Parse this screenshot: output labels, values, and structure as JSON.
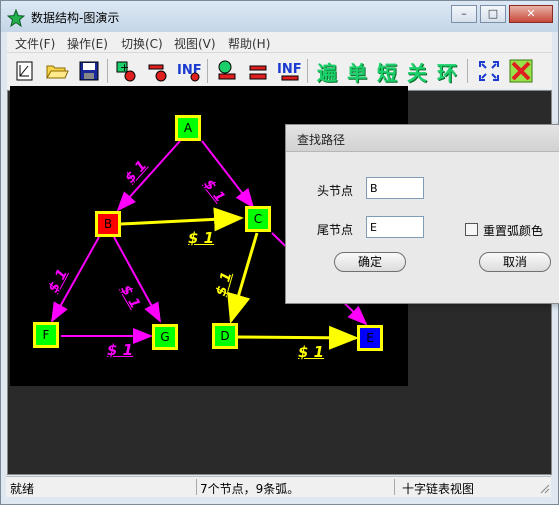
{
  "window": {
    "title": "数据结构-图演示",
    "controls": {
      "minimize": "–",
      "maximize": "□",
      "close": "✕"
    }
  },
  "menu": [
    "文件(F)",
    "操作(E)",
    "切换(C)",
    "视图(V)",
    "帮助(H)"
  ],
  "toolbar": {
    "icons": [
      "new-file-icon",
      "open-folder-icon",
      "save-icon",
      "add-node-icon",
      "delete-node-icon",
      "infinity-node-icon",
      "add-arc-icon",
      "delete-arc-icon",
      "infinity-arc-icon",
      "traverse-icon",
      "fit-view-icon",
      "close-red-icon"
    ],
    "text_buttons": [
      "遍",
      "单",
      "短",
      "关",
      "环"
    ]
  },
  "graph": {
    "nodes": [
      {
        "id": "A",
        "color": "#00ff00"
      },
      {
        "id": "B",
        "color": "#ff0000"
      },
      {
        "id": "C",
        "color": "#00ff00"
      },
      {
        "id": "D",
        "color": "#00ff00"
      },
      {
        "id": "E",
        "color": "#0000ff"
      },
      {
        "id": "F",
        "color": "#00ff00"
      },
      {
        "id": "G",
        "color": "#00ff00"
      }
    ],
    "edges": [
      {
        "from": "A",
        "to": "B",
        "label": "$ 1",
        "color": "#ff00ff"
      },
      {
        "from": "A",
        "to": "C",
        "label": "$ 1",
        "color": "#ff00ff"
      },
      {
        "from": "B",
        "to": "C",
        "label": "$ 1",
        "color": "#ffff00"
      },
      {
        "from": "B",
        "to": "F",
        "label": "$ 1",
        "color": "#ff00ff"
      },
      {
        "from": "B",
        "to": "G",
        "label": "$ 1",
        "color": "#ff00ff"
      },
      {
        "from": "F",
        "to": "G",
        "label": "$ 1",
        "color": "#ff00ff"
      },
      {
        "from": "C",
        "to": "D",
        "label": "$ 1",
        "color": "#ffff00"
      },
      {
        "from": "D",
        "to": "E",
        "label": "$ 1",
        "color": "#ffff00"
      },
      {
        "from": "C",
        "to": "E",
        "label": "",
        "color": "#ff00ff"
      }
    ]
  },
  "dialog": {
    "title": "查找路径",
    "head_label": "头节点",
    "head_value": "B",
    "tail_label": "尾节点",
    "tail_value": "E",
    "checkbox_label": "重置弧颜色",
    "ok": "确定",
    "cancel": "取消"
  },
  "status": {
    "left": "就绪",
    "middle": "7个节点，9条弧。",
    "right": "十字链表视图"
  }
}
